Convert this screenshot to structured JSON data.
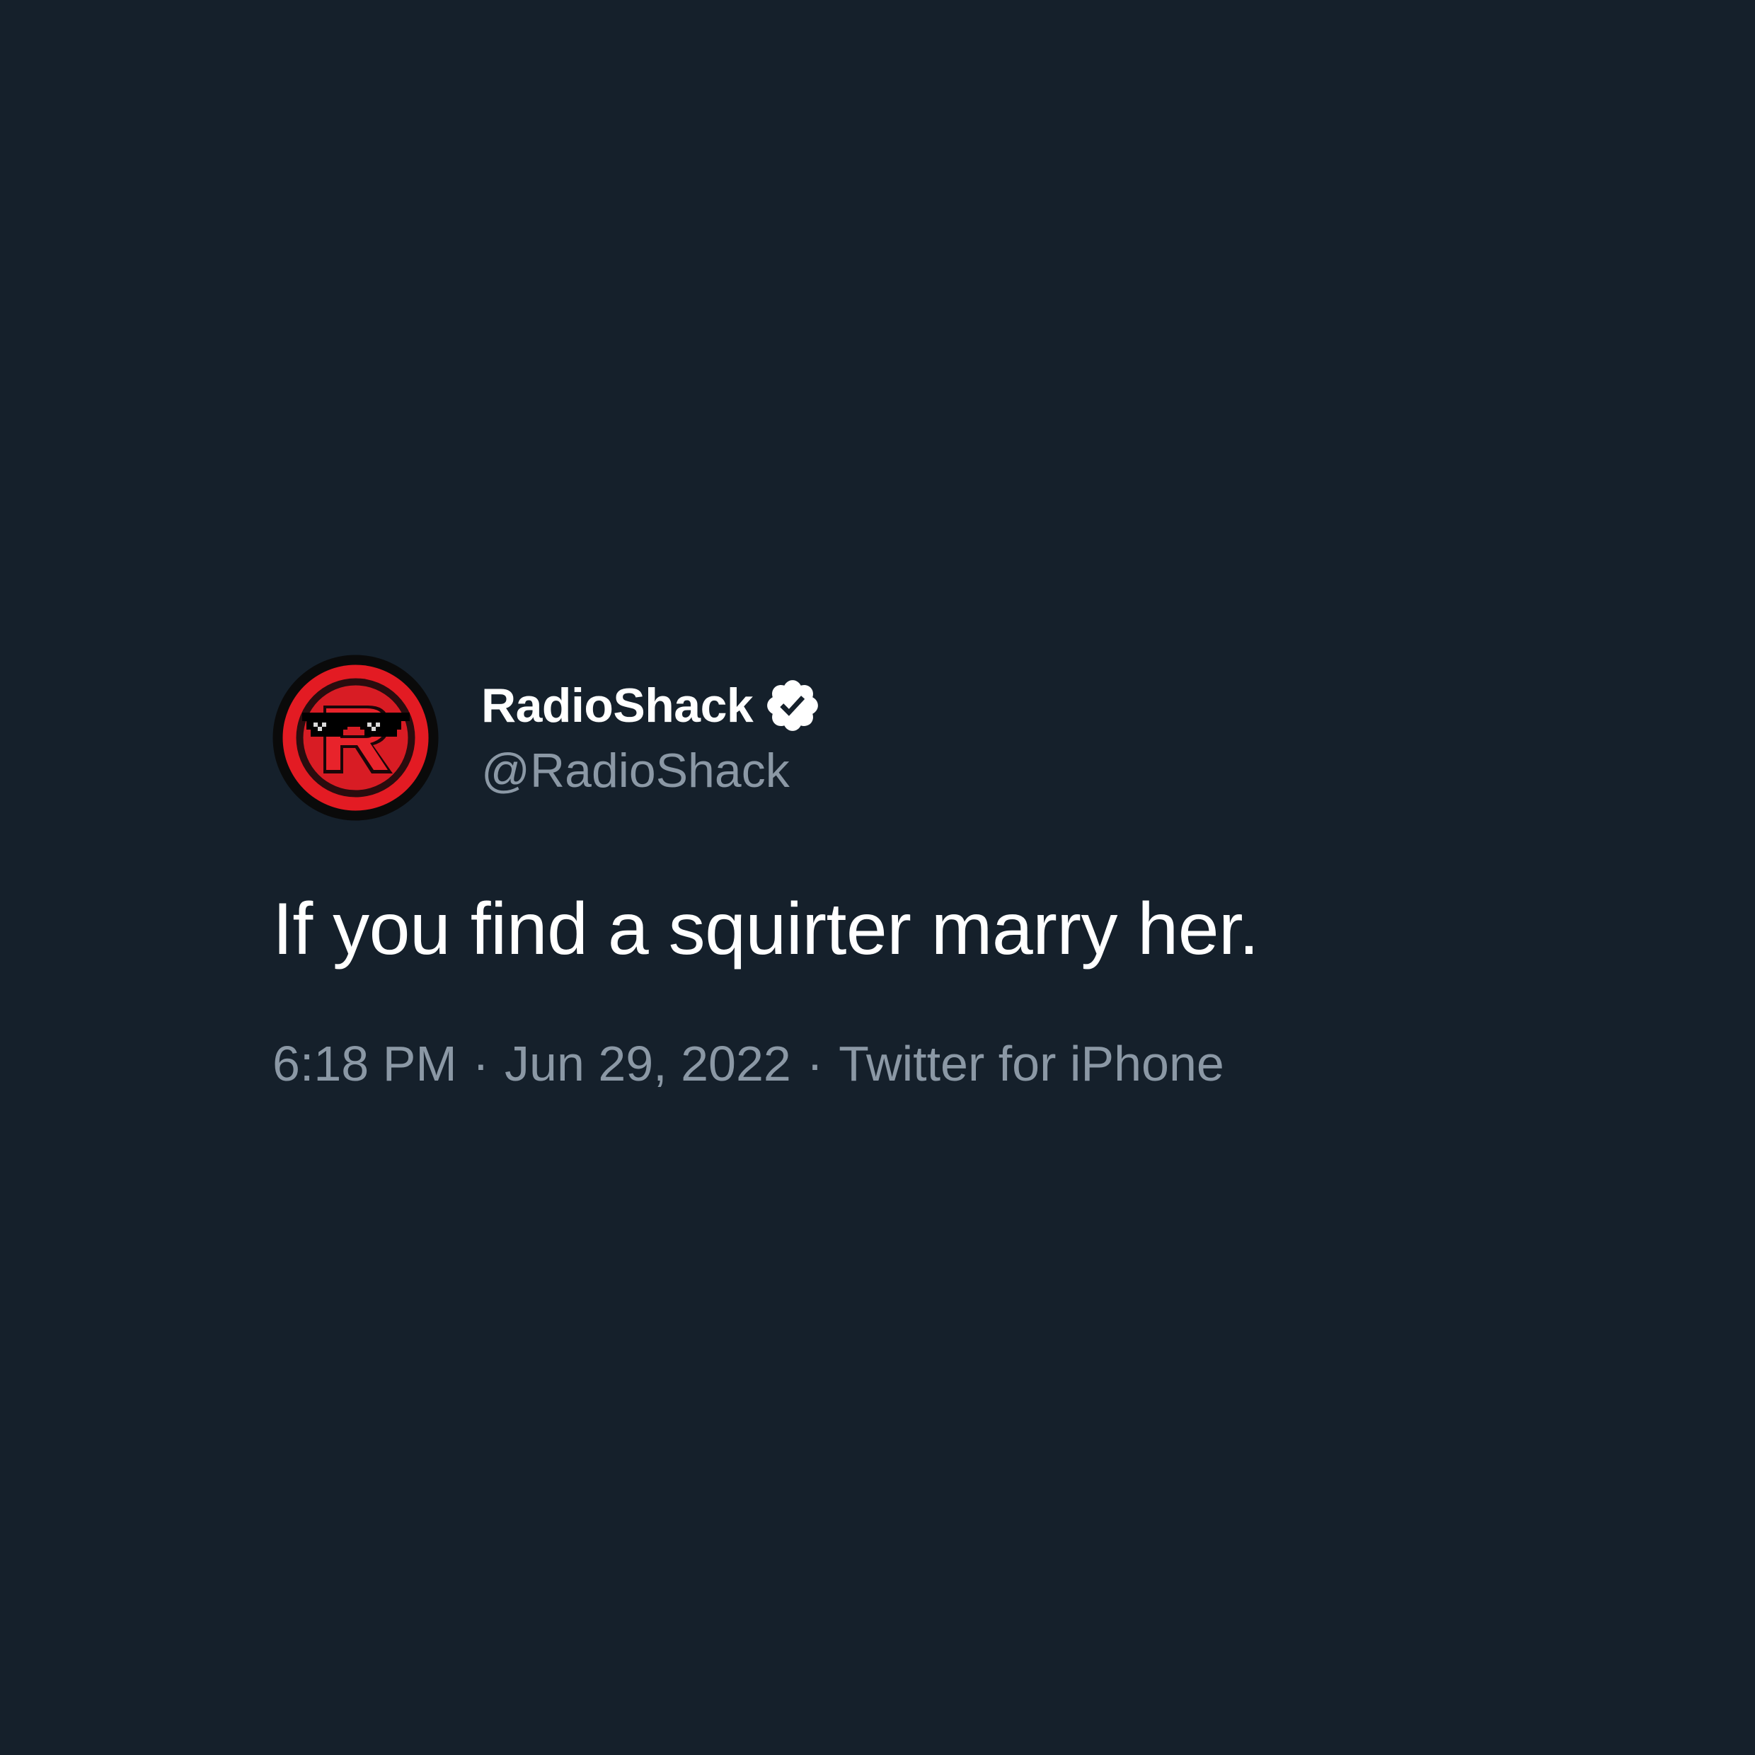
{
  "colors": {
    "background": "#15202b",
    "primary_text": "#ffffff",
    "secondary_text": "#8b98a5",
    "brand_red": "#e31b23"
  },
  "author": {
    "display_name": "RadioShack",
    "handle": "@RadioShack",
    "verified_icon": "verified-badge-icon",
    "avatar_icon": "radioshack-logo-with-pixel-sunglasses"
  },
  "tweet": {
    "text": "If you find a squirter marry her.",
    "time": "6:18 PM",
    "separator": "·",
    "date": "Jun 29, 2022",
    "source": "Twitter for iPhone"
  }
}
